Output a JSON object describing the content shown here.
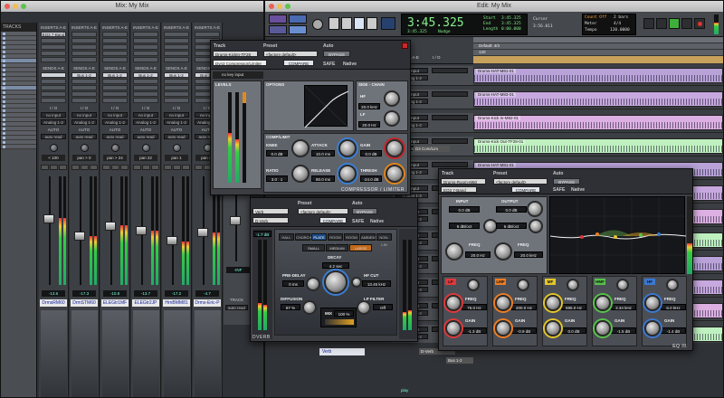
{
  "mix_window": {
    "title": "Mix: My Mix",
    "tracks_label": "TRACKS",
    "inserts_label": "INSERTS A-E",
    "sends_label": "SENDS A-E",
    "io_label": "I / O",
    "no_input": "no input",
    "output": "Analog 1-2",
    "auto_label": "AUTO",
    "auto_mode": "auto read",
    "strips": [
      {
        "insert": "",
        "send": "",
        "pan": "< 100",
        "vol": "-13.6",
        "name": "DrmsRM60",
        "level": 0.62
      },
      {
        "insert": "",
        "send": "Bus 1-2",
        "pan": "pan > 0",
        "vol": "-17.3",
        "name": "DrmSTM60",
        "level": 0.45
      },
      {
        "insert": "",
        "send": "Bus 1-2",
        "pan": "pan > 24",
        "vol": "-10.8",
        "name": "ELEGtr1MF",
        "level": 0.55
      },
      {
        "insert": "",
        "send": "Bus 1-2",
        "pan": "pan 22",
        "vol": "-13.7",
        "name": "ELEGtr2JP",
        "level": 0.5
      },
      {
        "insert": "",
        "send": "Bus 1-2",
        "pan": "pan 1",
        "vol": "-17.2",
        "name": "HrnBMM81",
        "level": 0.4
      },
      {
        "insert": "",
        "send": "Bus 1-2",
        "pan": "pan 30",
        "vol": "-4.7",
        "name": "Drms-Eric-P",
        "level": 0.48
      }
    ],
    "first_insert": "EQ3 7-Band",
    "track_label": "TRACK",
    "verb_send": "DrnmRM60",
    "send_a": "send a",
    "safe_label": "SAFE",
    "pre_label": "PRE",
    "fmp_label": "FMP",
    "send_level": "-INF"
  },
  "edit_window": {
    "title": "Edit: My Mix",
    "counter_main": "3:45.325",
    "counter_start_label": "Start",
    "counter_start": "3:45.325",
    "counter_end_label": "End",
    "counter_end": "3:45.325",
    "counter_len_label": "Length",
    "counter_len": "0:00.000",
    "nudge_label": "Nudge",
    "nudge_value": "0:01.000",
    "cursor_label": "Cursor",
    "cursor_value": "3:56.011",
    "count_off": "Count Off",
    "meter_label": "Meter",
    "tempo_label": "Tempo",
    "bars_label": "2 bars",
    "meter_value": "4/4",
    "tempo_value": "120.0000",
    "default_label": "Default: 4/4",
    "tempo_marker": "120",
    "clips": [
      {
        "name": "Drums-HAT-M81-01",
        "color": "#b8a2d8"
      },
      {
        "name": "Drums-HAT-M83-01",
        "color": "#c7a8df"
      },
      {
        "name": "Drums-Kick In-M82-01",
        "color": "#dcb0e3"
      },
      {
        "name": "Drums-Kick Out-TF28-01",
        "color": "#bff0c0"
      }
    ],
    "track_names": [
      "Drums-HAT-M81-01",
      "Drums-HAT-M83-01",
      "Drums-Kick In-M82-01",
      "Drums-Kick Out-TF28-01"
    ],
    "bottom_track": "Verb",
    "bottom_out": "D-Verb",
    "bottom_bus": "Bus 1-2",
    "bottom_play": "play",
    "comp_lim_label": "D3 Com/Lim",
    "hdr_insert": "INSERTS A-E",
    "hdr_send": "SENDS A-E",
    "hdr_io": "I / O"
  },
  "comp_plugin": {
    "track_label": "Track",
    "track_value": "Drums-KickIn-TF28",
    "preset_label": "Preset",
    "preset_value": "<factory default>",
    "auto_label": "Auto",
    "bypass": "BYPASS",
    "compare": "COMPARE",
    "safe": "SAFE",
    "native": "Native",
    "insert_name": "Dyn3 Compressor/Limiter",
    "no_key": "no key input",
    "levels_label": "LEVELS",
    "options_label": "OPTIONS",
    "sidechain_label": "SIDE - CHAIN",
    "complimit_label": "COMP/LIMIT",
    "knee_label": "KNEE",
    "knee_value": "0.0 dB",
    "attack_label": "ATTACK",
    "attack_value": "10.0 ms",
    "gain_label": "GAIN",
    "gain_value": "0.0 dB",
    "ratio_label": "RATIO",
    "ratio_value": "3.0 : 1",
    "release_label": "RELEASE",
    "release_value": "80.0 ms",
    "thresh_label": "THRESH",
    "thresh_value": "-24.0 dB",
    "hf_label": "HF",
    "hf_value": "20.0 kHz",
    "lf_label": "LF",
    "lf_value": "20.0 Hz",
    "brand": "COMPRESSOR / LIMITER"
  },
  "verb_plugin": {
    "track_value": "Verb",
    "preset_label": "Preset",
    "preset_value": "<factory default>",
    "auto_label": "Auto",
    "bypass": "BYPASS",
    "compare": "COMPARE",
    "safe": "SAFE",
    "native": "Native",
    "insert_value": "D-Verb",
    "algorithms": [
      "HALL",
      "CHURCH",
      "PLATE",
      "ROOM 1",
      "ROOM 2",
      "AMBIENT",
      "NON-LIN"
    ],
    "sizes": [
      "SMALL",
      "MEDIUM",
      "LARGE"
    ],
    "decay_label": "DECAY",
    "decay_value": "4.2 sec",
    "predelay_label": "PRE-DELAY",
    "predelay_value": "0 ms",
    "hfcut_label": "HF CUT",
    "hfcut_value": "13.45 kHz",
    "diffusion_label": "DIFFUSION",
    "diffusion_value": "87 %",
    "lpfilter_label": "LP FILTER",
    "lpfilter_value": "Off",
    "mix_label": "MIX",
    "mix_value": "100 %",
    "input_label": "INPUT",
    "input_value": "-1.7 dB",
    "brand": "DVERB"
  },
  "eq_plugin": {
    "track_label": "Track",
    "track_value": "Drums-Room-M60",
    "preset_label": "Preset",
    "preset_value": "<factory default>",
    "auto_label": "Auto",
    "bypass": "BYPASS",
    "compare": "COMPARE",
    "safe": "SAFE",
    "native": "Native",
    "insert_value": "EQ3 7-Band",
    "input_label": "INPUT",
    "input_value": "0.0 dB",
    "output_label": "OUTPUT",
    "output_value": "0.0 dB",
    "hpf_freq_label": "FREQ",
    "hpf_freq_value": "20.0 Hz",
    "lpf_freq_label": "FREQ",
    "lpf_freq_value": "20.0 kHz",
    "notch_label": "6 dB/oct",
    "bands": [
      {
        "tag": "LF",
        "color": "#e0383a",
        "freq": "75.0 Hz",
        "gain": "-1.3 dB"
      },
      {
        "tag": "LMF",
        "color": "#ee7d22",
        "freq": "200.0 Hz",
        "gain": "-0.9 dB"
      },
      {
        "tag": "MF",
        "color": "#e2c52a",
        "freq": "595.0 Hz",
        "gain": "0.0 dB"
      },
      {
        "tag": "HMF",
        "color": "#58c24a",
        "freq": "3.34 kHz",
        "gain": "-1.5 dB"
      },
      {
        "tag": "HF",
        "color": "#3a78d2",
        "freq": "6.0 kHz",
        "gain": "-1.4 dB"
      }
    ],
    "band_freq_label": "FREQ",
    "band_gain_label": "GAIN",
    "brand": "EQ III"
  }
}
